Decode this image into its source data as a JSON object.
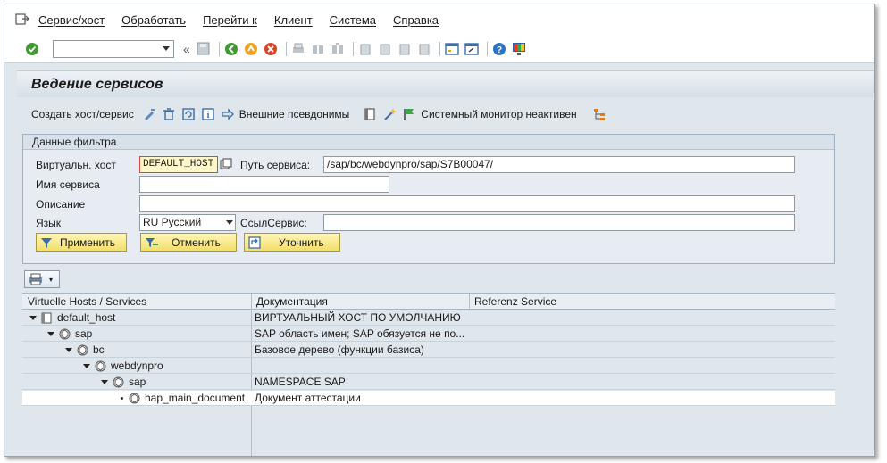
{
  "menu": {
    "items": [
      "Сервис/хост",
      "Обработать",
      "Перейти к",
      "Клиент",
      "Система",
      "Справка"
    ]
  },
  "toolbar": {
    "command_value": "",
    "collapse_glyph": "«"
  },
  "title": "Ведение сервисов",
  "app_toolbar": {
    "create_label": "Создать хост/сервис",
    "aliases_label": "Внешние псевдонимы",
    "monitor_label": "Системный монитор неактивен"
  },
  "filter": {
    "group_title": "Данные фильтра",
    "virtual_host_label": "Виртуальн. хост",
    "virtual_host_value": "DEFAULT_HOST",
    "service_path_label": "Путь сервиса:",
    "service_path_value": "/sap/bc/webdynpro/sap/S7B00047/",
    "service_name_label": "Имя сервиса",
    "service_name_value": "",
    "description_label": "Описание",
    "description_value": "",
    "language_label": "Язык",
    "language_value": "RU Русский",
    "ref_service_label": "СсылСервис:",
    "ref_service_value": "",
    "apply_label": "Применить",
    "cancel_label": "Отменить",
    "refine_label": "Уточнить"
  },
  "tree": {
    "columns": [
      "Virtuelle Hosts / Services",
      "Документация",
      "Referenz Service"
    ],
    "rows": [
      {
        "name": "default_host",
        "doc": "ВИРТУАЛЬНЫЙ ХОСТ ПО УМОЛЧАНИЮ",
        "ref": "",
        "expanded": true
      },
      {
        "name": "sap",
        "doc": "SAP область имен; SAP обязуется не по...",
        "ref": "",
        "expanded": true
      },
      {
        "name": "bc",
        "doc": "Базовое дерево (функции базиса)",
        "ref": "",
        "expanded": true
      },
      {
        "name": "webdynpro",
        "doc": "",
        "ref": "",
        "expanded": true
      },
      {
        "name": "sap",
        "doc": "NAMESPACE SAP",
        "ref": "",
        "expanded": true
      },
      {
        "name": "hap_main_document",
        "doc": "Документ аттестации",
        "ref": "",
        "expanded": false
      }
    ]
  }
}
